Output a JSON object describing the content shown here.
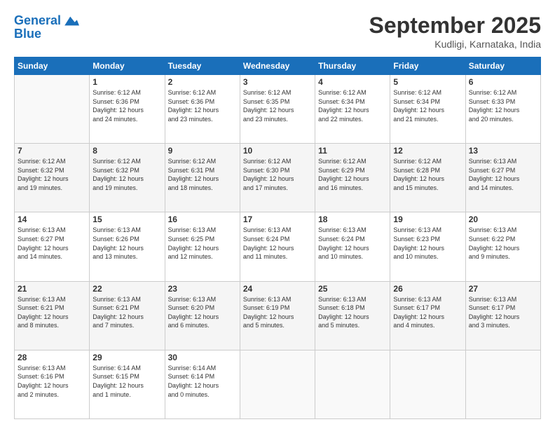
{
  "logo": {
    "line1": "General",
    "line2": "Blue"
  },
  "title": "September 2025",
  "location": "Kudligi, Karnataka, India",
  "days_header": [
    "Sunday",
    "Monday",
    "Tuesday",
    "Wednesday",
    "Thursday",
    "Friday",
    "Saturday"
  ],
  "weeks": [
    [
      {
        "day": "",
        "info": ""
      },
      {
        "day": "1",
        "info": "Sunrise: 6:12 AM\nSunset: 6:36 PM\nDaylight: 12 hours\nand 24 minutes."
      },
      {
        "day": "2",
        "info": "Sunrise: 6:12 AM\nSunset: 6:36 PM\nDaylight: 12 hours\nand 23 minutes."
      },
      {
        "day": "3",
        "info": "Sunrise: 6:12 AM\nSunset: 6:35 PM\nDaylight: 12 hours\nand 23 minutes."
      },
      {
        "day": "4",
        "info": "Sunrise: 6:12 AM\nSunset: 6:34 PM\nDaylight: 12 hours\nand 22 minutes."
      },
      {
        "day": "5",
        "info": "Sunrise: 6:12 AM\nSunset: 6:34 PM\nDaylight: 12 hours\nand 21 minutes."
      },
      {
        "day": "6",
        "info": "Sunrise: 6:12 AM\nSunset: 6:33 PM\nDaylight: 12 hours\nand 20 minutes."
      }
    ],
    [
      {
        "day": "7",
        "info": "Sunrise: 6:12 AM\nSunset: 6:32 PM\nDaylight: 12 hours\nand 19 minutes."
      },
      {
        "day": "8",
        "info": "Sunrise: 6:12 AM\nSunset: 6:32 PM\nDaylight: 12 hours\nand 19 minutes."
      },
      {
        "day": "9",
        "info": "Sunrise: 6:12 AM\nSunset: 6:31 PM\nDaylight: 12 hours\nand 18 minutes."
      },
      {
        "day": "10",
        "info": "Sunrise: 6:12 AM\nSunset: 6:30 PM\nDaylight: 12 hours\nand 17 minutes."
      },
      {
        "day": "11",
        "info": "Sunrise: 6:12 AM\nSunset: 6:29 PM\nDaylight: 12 hours\nand 16 minutes."
      },
      {
        "day": "12",
        "info": "Sunrise: 6:12 AM\nSunset: 6:28 PM\nDaylight: 12 hours\nand 15 minutes."
      },
      {
        "day": "13",
        "info": "Sunrise: 6:13 AM\nSunset: 6:27 PM\nDaylight: 12 hours\nand 14 minutes."
      }
    ],
    [
      {
        "day": "14",
        "info": "Sunrise: 6:13 AM\nSunset: 6:27 PM\nDaylight: 12 hours\nand 14 minutes."
      },
      {
        "day": "15",
        "info": "Sunrise: 6:13 AM\nSunset: 6:26 PM\nDaylight: 12 hours\nand 13 minutes."
      },
      {
        "day": "16",
        "info": "Sunrise: 6:13 AM\nSunset: 6:25 PM\nDaylight: 12 hours\nand 12 minutes."
      },
      {
        "day": "17",
        "info": "Sunrise: 6:13 AM\nSunset: 6:24 PM\nDaylight: 12 hours\nand 11 minutes."
      },
      {
        "day": "18",
        "info": "Sunrise: 6:13 AM\nSunset: 6:24 PM\nDaylight: 12 hours\nand 10 minutes."
      },
      {
        "day": "19",
        "info": "Sunrise: 6:13 AM\nSunset: 6:23 PM\nDaylight: 12 hours\nand 10 minutes."
      },
      {
        "day": "20",
        "info": "Sunrise: 6:13 AM\nSunset: 6:22 PM\nDaylight: 12 hours\nand 9 minutes."
      }
    ],
    [
      {
        "day": "21",
        "info": "Sunrise: 6:13 AM\nSunset: 6:21 PM\nDaylight: 12 hours\nand 8 minutes."
      },
      {
        "day": "22",
        "info": "Sunrise: 6:13 AM\nSunset: 6:21 PM\nDaylight: 12 hours\nand 7 minutes."
      },
      {
        "day": "23",
        "info": "Sunrise: 6:13 AM\nSunset: 6:20 PM\nDaylight: 12 hours\nand 6 minutes."
      },
      {
        "day": "24",
        "info": "Sunrise: 6:13 AM\nSunset: 6:19 PM\nDaylight: 12 hours\nand 5 minutes."
      },
      {
        "day": "25",
        "info": "Sunrise: 6:13 AM\nSunset: 6:18 PM\nDaylight: 12 hours\nand 5 minutes."
      },
      {
        "day": "26",
        "info": "Sunrise: 6:13 AM\nSunset: 6:17 PM\nDaylight: 12 hours\nand 4 minutes."
      },
      {
        "day": "27",
        "info": "Sunrise: 6:13 AM\nSunset: 6:17 PM\nDaylight: 12 hours\nand 3 minutes."
      }
    ],
    [
      {
        "day": "28",
        "info": "Sunrise: 6:13 AM\nSunset: 6:16 PM\nDaylight: 12 hours\nand 2 minutes."
      },
      {
        "day": "29",
        "info": "Sunrise: 6:14 AM\nSunset: 6:15 PM\nDaylight: 12 hours\nand 1 minute."
      },
      {
        "day": "30",
        "info": "Sunrise: 6:14 AM\nSunset: 6:14 PM\nDaylight: 12 hours\nand 0 minutes."
      },
      {
        "day": "",
        "info": ""
      },
      {
        "day": "",
        "info": ""
      },
      {
        "day": "",
        "info": ""
      },
      {
        "day": "",
        "info": ""
      }
    ]
  ]
}
